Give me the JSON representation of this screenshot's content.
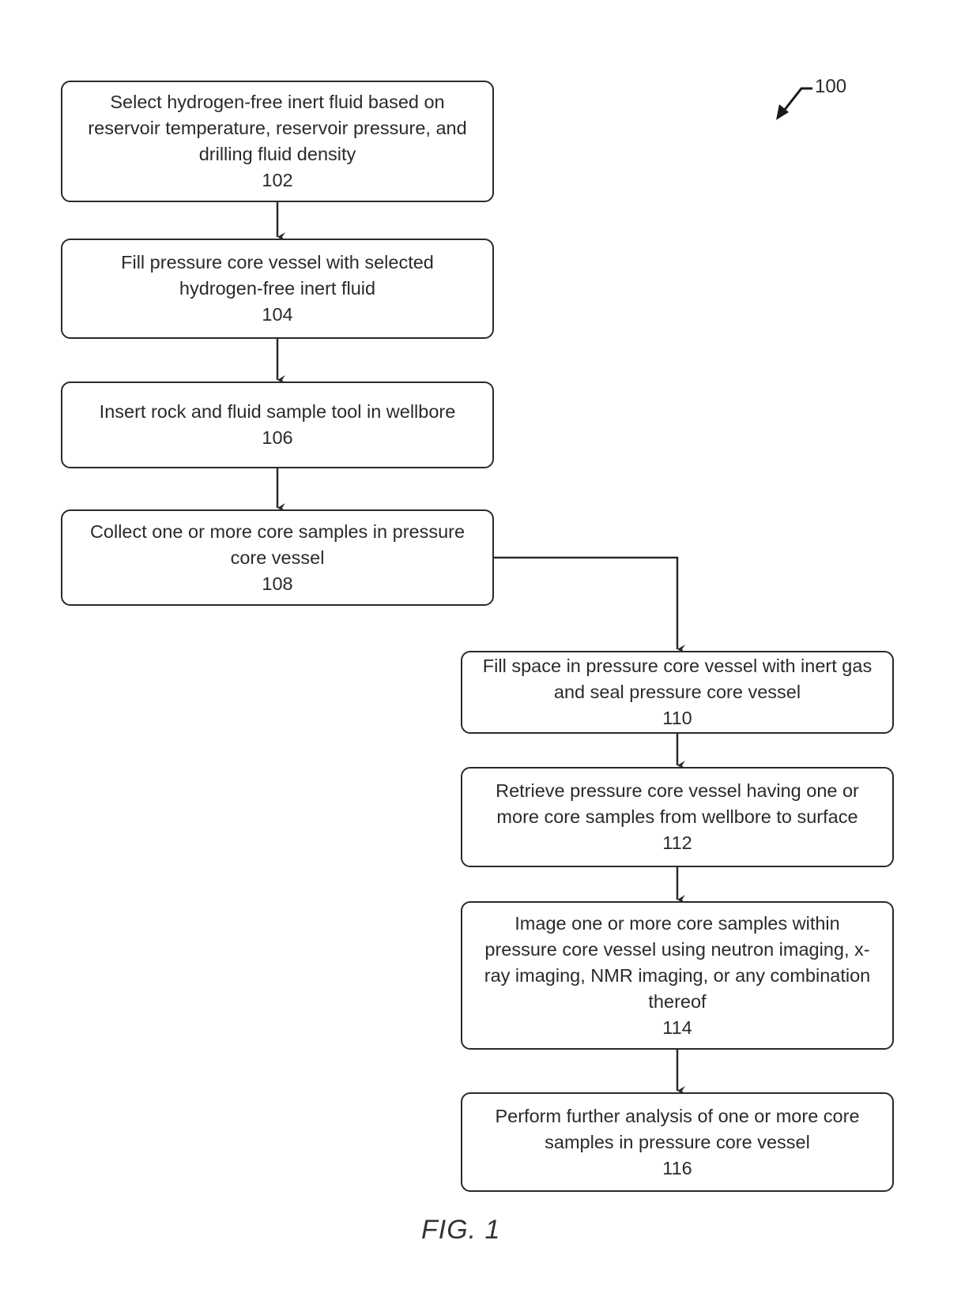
{
  "figure": {
    "caption": "FIG. 1",
    "reference_number": "100"
  },
  "steps": [
    {
      "id": "102",
      "text": "Select hydrogen-free inert fluid based on\nreservoir temperature, reservoir pressure, and\ndrilling fluid density"
    },
    {
      "id": "104",
      "text": "Fill pressure core vessel with selected\nhydrogen-free inert fluid"
    },
    {
      "id": "106",
      "text": "Insert rock and fluid sample tool in wellbore"
    },
    {
      "id": "108",
      "text": "Collect one or more core samples in pressure\ncore vessel"
    },
    {
      "id": "110",
      "text": "Fill space in pressure core vessel with inert gas\nand seal pressure core vessel"
    },
    {
      "id": "112",
      "text": "Retrieve  pressure core vessel having one or\nmore core samples from wellbore to surface"
    },
    {
      "id": "114",
      "text": "Image one or more core samples within\npressure core vessel using neutron imaging, x-\nray imaging, NMR imaging, or any combination\nthereof"
    },
    {
      "id": "116",
      "text": "Perform further analysis of one or more core\nsamples in pressure core vessel"
    }
  ],
  "flow": [
    [
      "102",
      "104"
    ],
    [
      "104",
      "106"
    ],
    [
      "106",
      "108"
    ],
    [
      "108",
      "110"
    ],
    [
      "110",
      "112"
    ],
    [
      "112",
      "114"
    ],
    [
      "114",
      "116"
    ]
  ],
  "colors": {
    "stroke": "#2a2a2a",
    "background": "#ffffff"
  }
}
